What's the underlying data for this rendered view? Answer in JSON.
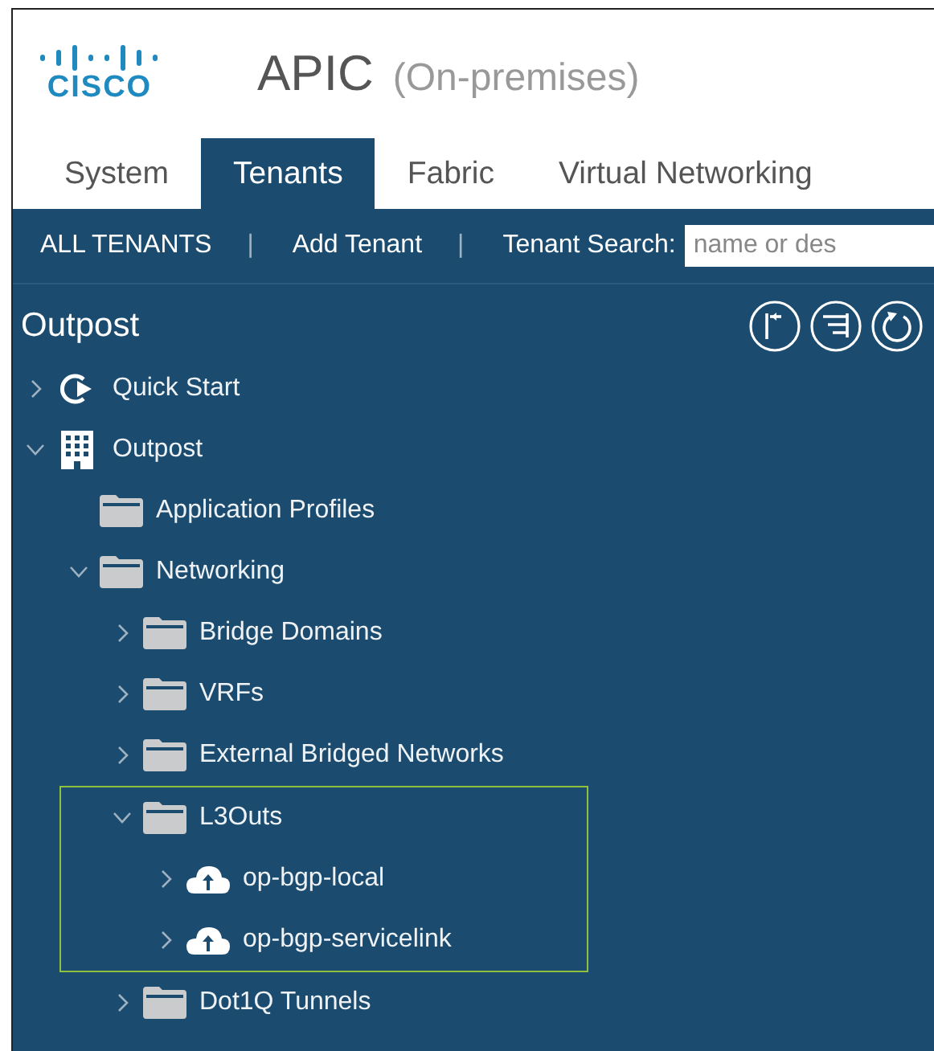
{
  "header": {
    "logo": "CISCO",
    "title": "APIC",
    "subtitle": "(On-premises)"
  },
  "tabs": [
    {
      "label": "System",
      "selected": false
    },
    {
      "label": "Tenants",
      "selected": true
    },
    {
      "label": "Fabric",
      "selected": false
    },
    {
      "label": "Virtual Networking",
      "selected": false
    }
  ],
  "toolbar": {
    "items": [
      {
        "kind": "link",
        "label": "ALL TENANTS"
      },
      {
        "kind": "separator",
        "label": "|"
      },
      {
        "kind": "link",
        "label": "Add Tenant"
      },
      {
        "kind": "separator",
        "label": "|"
      },
      {
        "kind": "label",
        "label": "Tenant Search:"
      },
      {
        "kind": "search",
        "placeholder": "name or des"
      }
    ]
  },
  "panel": {
    "title": "Outpost"
  },
  "tree": [
    {
      "label": "Quick Start",
      "kind": "quick-start",
      "expanded": false
    },
    {
      "label": "Outpost",
      "kind": "tenant",
      "expanded": true,
      "children": [
        {
          "label": "Application Profiles",
          "kind": "folder"
        },
        {
          "label": "Networking",
          "kind": "folder",
          "expanded": true,
          "children": [
            {
              "label": "Bridge Domains",
              "kind": "folder",
              "expanded": false
            },
            {
              "label": "VRFs",
              "kind": "folder",
              "expanded": false
            },
            {
              "label": "External Bridged Networks",
              "kind": "folder",
              "expanded": false
            },
            {
              "label": "L3Outs",
              "kind": "folder",
              "expanded": true,
              "highlighted": true,
              "children": [
                {
                  "label": "op-bgp-local",
                  "kind": "l3out",
                  "expanded": false
                },
                {
                  "label": "op-bgp-servicelink",
                  "kind": "l3out",
                  "expanded": false
                }
              ]
            },
            {
              "label": "Dot1Q Tunnels",
              "kind": "folder",
              "expanded": false
            }
          ]
        }
      ]
    }
  ]
}
